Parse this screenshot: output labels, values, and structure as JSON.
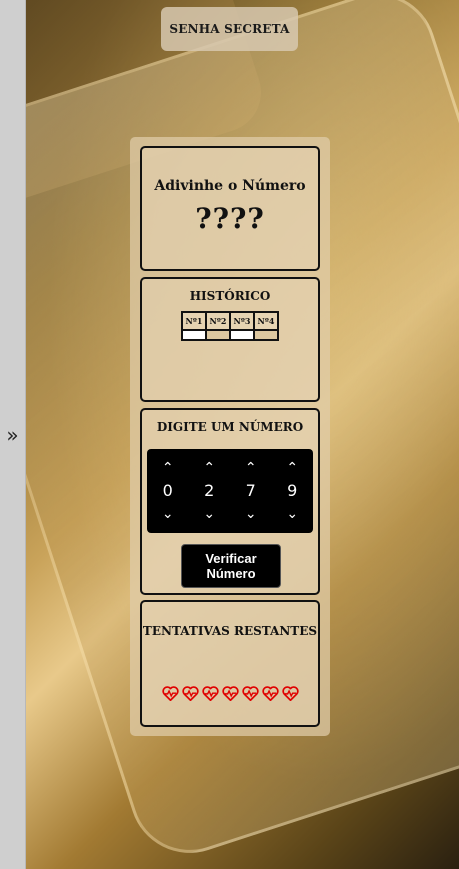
{
  "side_panel": {
    "icon": "double-chevron-right-icon",
    "glyph": "»"
  },
  "header": {
    "secret_button_label": "SENHA SECRETA"
  },
  "guess_card": {
    "title": "Adivinhe o Número",
    "masked_number": "????"
  },
  "history": {
    "title": "HISTÓRICO",
    "columns": [
      "Nº1",
      "Nº2",
      "Nº3",
      "Nº4"
    ]
  },
  "input": {
    "title": "DIGITE UM NÚMERO",
    "digits": [
      "0",
      "2",
      "7",
      "9"
    ],
    "verify_label": "Verificar Número"
  },
  "attempts": {
    "title": "TENTATIVAS RESTANTES",
    "remaining": 7,
    "heart_icon": "heart-pulse-icon",
    "heart_color": "#e00000"
  }
}
